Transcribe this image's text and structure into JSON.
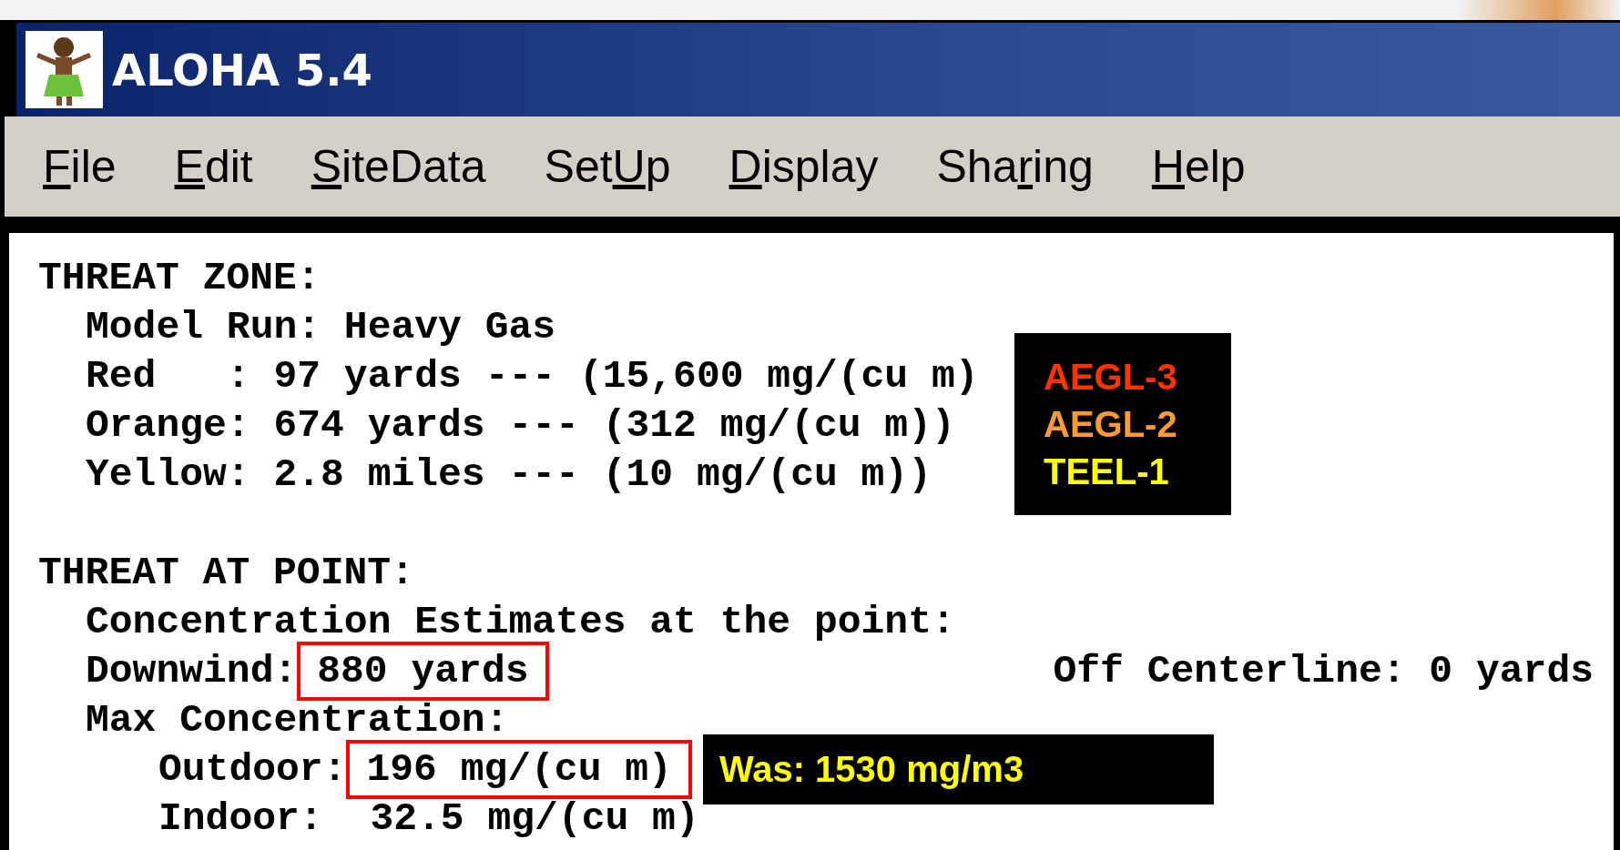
{
  "window": {
    "title": "ALOHA 5.4"
  },
  "menu": [
    {
      "runs": [
        {
          "text": "F",
          "underlined": true
        },
        {
          "text": "ile",
          "underlined": false
        }
      ]
    },
    {
      "runs": [
        {
          "text": "E",
          "underlined": true
        },
        {
          "text": "dit",
          "underlined": false
        }
      ]
    },
    {
      "runs": [
        {
          "text": "S",
          "underlined": true
        },
        {
          "text": "iteData",
          "underlined": false
        }
      ]
    },
    {
      "runs": [
        {
          "text": "Set",
          "underlined": false
        },
        {
          "text": "U",
          "underlined": true
        },
        {
          "text": "p",
          "underlined": false
        }
      ]
    },
    {
      "runs": [
        {
          "text": "D",
          "underlined": true
        },
        {
          "text": "isplay",
          "underlined": false
        }
      ]
    },
    {
      "runs": [
        {
          "text": "Sha",
          "underlined": false
        },
        {
          "text": "r",
          "underlined": true
        },
        {
          "text": "ing",
          "underlined": false
        }
      ]
    },
    {
      "runs": [
        {
          "text": "H",
          "underlined": true
        },
        {
          "text": "elp",
          "underlined": false
        }
      ]
    }
  ],
  "report": [
    {
      "heading": "THREAT ZONE:",
      "children": [
        {
          "text": "Model Run: Heavy Gas"
        },
        {
          "text": "Red   : 97 yards --- (15,600 mg/(cu m)"
        },
        {
          "text": "Orange: 674 yards --- (312 mg/(cu m))"
        },
        {
          "text": "Yellow: 2.8 miles --- (10 mg/(cu m))"
        }
      ],
      "legend": [
        {
          "label": "AEGL-3",
          "color": "#ff3300"
        },
        {
          "label": "AEGL-2",
          "color": "#ff9933"
        },
        {
          "label": "TEEL-1",
          "color": "#ffff00"
        }
      ]
    },
    {
      "heading": "THREAT AT POINT:",
      "children": [
        {
          "text": "Concentration Estimates at the point:"
        },
        {
          "text": "Downwind:",
          "value": "880 yards",
          "highlighted": true,
          "right": "Off Centerline: 0 yards"
        },
        {
          "text": "Max Concentration:",
          "children": [
            {
              "text": "Outdoor:",
              "value": "196 mg/(cu m)",
              "highlighted": true,
              "note": "Was: 1530 mg/m3"
            },
            {
              "text": "Indoor: ",
              "value": "32.5 mg/(cu m)",
              "highlighted": false
            }
          ]
        }
      ]
    }
  ]
}
